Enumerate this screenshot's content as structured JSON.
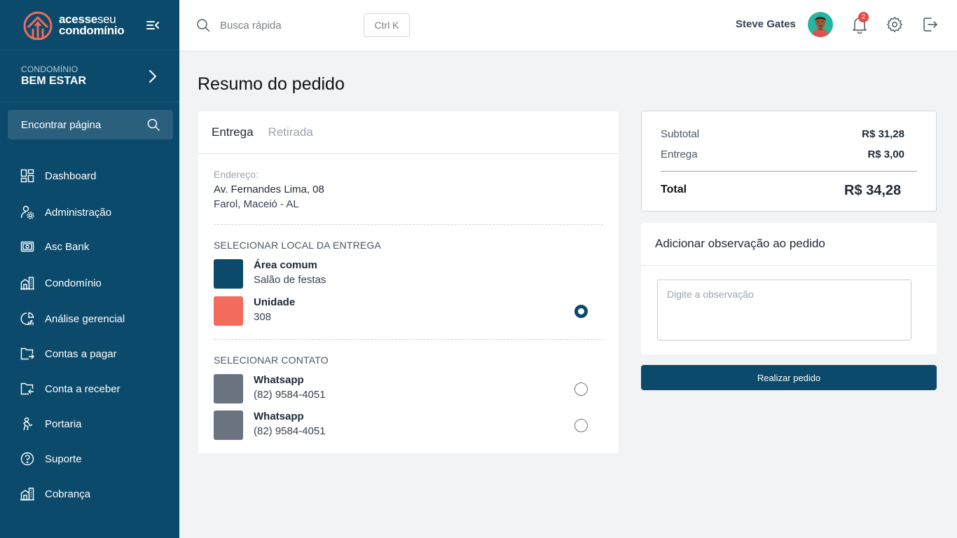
{
  "brand": {
    "line1_bold": "acesse",
    "line1_thin": "seu",
    "line2": "condomínio"
  },
  "condo": {
    "caption": "CONDOMÍNIO",
    "name": "BEM ESTAR"
  },
  "sidebar_search": {
    "label": "Encontrar página"
  },
  "nav": [
    {
      "label": "Dashboard",
      "icon": "dashboard-icon"
    },
    {
      "label": "Administração",
      "icon": "admin-gear-icon"
    },
    {
      "label": "Asc Bank",
      "icon": "bank-icon"
    },
    {
      "label": "Condomínio",
      "icon": "building-icon"
    },
    {
      "label": "Análise gerencial",
      "icon": "analytics-icon"
    },
    {
      "label": "Contas a pagar",
      "icon": "folder-out-icon"
    },
    {
      "label": "Conta a receber",
      "icon": "folder-in-icon"
    },
    {
      "label": "Portaria",
      "icon": "doorman-icon"
    },
    {
      "label": "Suporte",
      "icon": "help-icon"
    },
    {
      "label": "Cobrança",
      "icon": "billing-building-icon"
    }
  ],
  "topbar": {
    "search_placeholder": "Busca rápida",
    "shortcut": "Ctrl K",
    "user_name": "Steve Gates",
    "notifications_count": "2"
  },
  "page": {
    "title": "Resumo do pedido"
  },
  "tabs": [
    {
      "label": "Entrega",
      "active": true
    },
    {
      "label": "Retirada",
      "active": false
    }
  ],
  "address": {
    "caption": "Endereço:",
    "line1": "Av. Fernandes Lima, 08",
    "line2": "Farol, Maceió - AL"
  },
  "delivery_section": {
    "title": "SELECIONAR LOCAL DA ENTREGA",
    "options": [
      {
        "title": "Área comum",
        "subtitle": "Salão de festas",
        "color": "#0b4a6b",
        "selected": false,
        "has_radio": false
      },
      {
        "title": "Unidade",
        "subtitle": "308",
        "color": "#f26b5b",
        "selected": true,
        "has_radio": true
      }
    ]
  },
  "contact_section": {
    "title": "SELECIONAR CONTATO",
    "options": [
      {
        "title": "Whatsapp",
        "subtitle": "(82) 9584-4051",
        "color": "#6b7280",
        "selected": false
      },
      {
        "title": "Whatsapp",
        "subtitle": "(82) 9584-4051",
        "color": "#6b7280",
        "selected": false
      }
    ]
  },
  "summary": {
    "subtotal_label": "Subtotal",
    "subtotal_value": "R$ 31,28",
    "delivery_label": "Entrega",
    "delivery_value": "R$ 3,00",
    "total_label": "Total",
    "total_value": "R$ 34,28"
  },
  "observation": {
    "title": "Adicionar observação ao pedido",
    "placeholder": "Digite a observação"
  },
  "order_button": {
    "label": "Realizar pedido"
  },
  "colors": {
    "primary": "#0b4a6b",
    "accent": "#f26b5b",
    "badge": "#ef4444"
  }
}
